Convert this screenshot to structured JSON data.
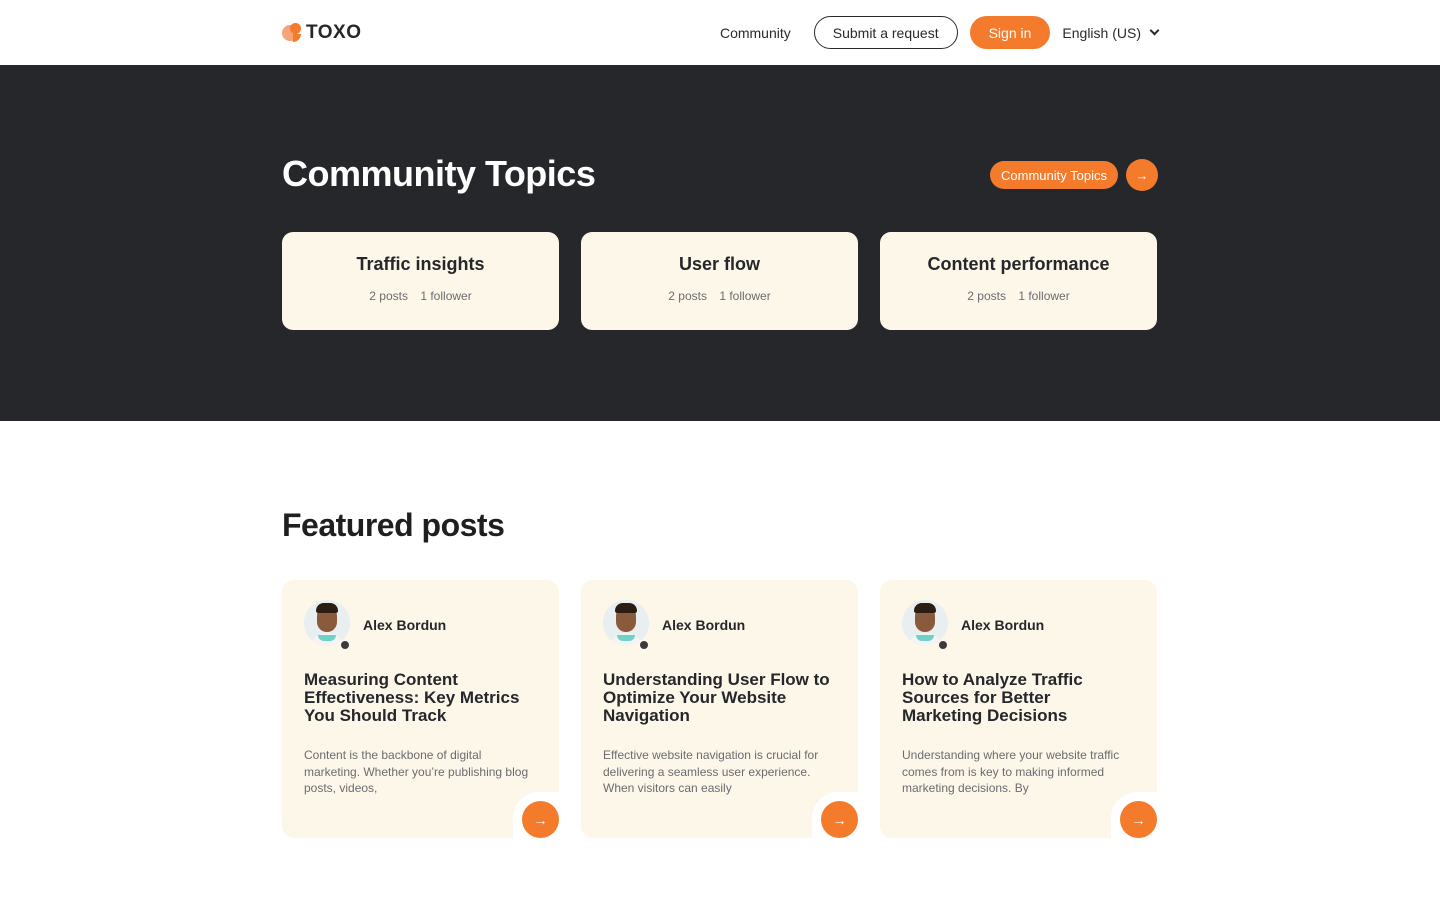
{
  "header": {
    "logo_text": "TOXO",
    "nav_community": "Community",
    "submit_request": "Submit a request",
    "sign_in": "Sign in",
    "language": "English (US)"
  },
  "hero": {
    "title": "Community Topics",
    "cta_label": "Community Topics",
    "cta_arrow": "→",
    "topics": [
      {
        "name": "Traffic insights",
        "posts": "2 posts",
        "followers": "1 follower"
      },
      {
        "name": "User flow",
        "posts": "2 posts",
        "followers": "1 follower"
      },
      {
        "name": "Content performance",
        "posts": "2 posts",
        "followers": "1 follower"
      }
    ]
  },
  "featured": {
    "title": "Featured posts",
    "posts": [
      {
        "author": "Alex Bordun",
        "title": "Measuring Content Effectiveness: Key Metrics You Should Track",
        "excerpt": "Content is the backbone of digital marketing. Whether you’re publishing blog posts, videos,",
        "arrow": "→"
      },
      {
        "author": "Alex Bordun",
        "title": "Understanding User Flow to Optimize Your Website Navigation",
        "excerpt": "Effective website navigation is crucial for delivering a seamless user experience. When visitors can easily",
        "arrow": "→"
      },
      {
        "author": "Alex Bordun",
        "title": "How to Analyze Traffic Sources for Better Marketing Decisions",
        "excerpt": "Understanding where your website traffic comes from is key to making informed marketing decisions. By",
        "arrow": "→"
      }
    ]
  },
  "colors": {
    "accent": "#f47a2c",
    "dark_bg": "#26272b",
    "card_bg": "#fdf7ea"
  }
}
